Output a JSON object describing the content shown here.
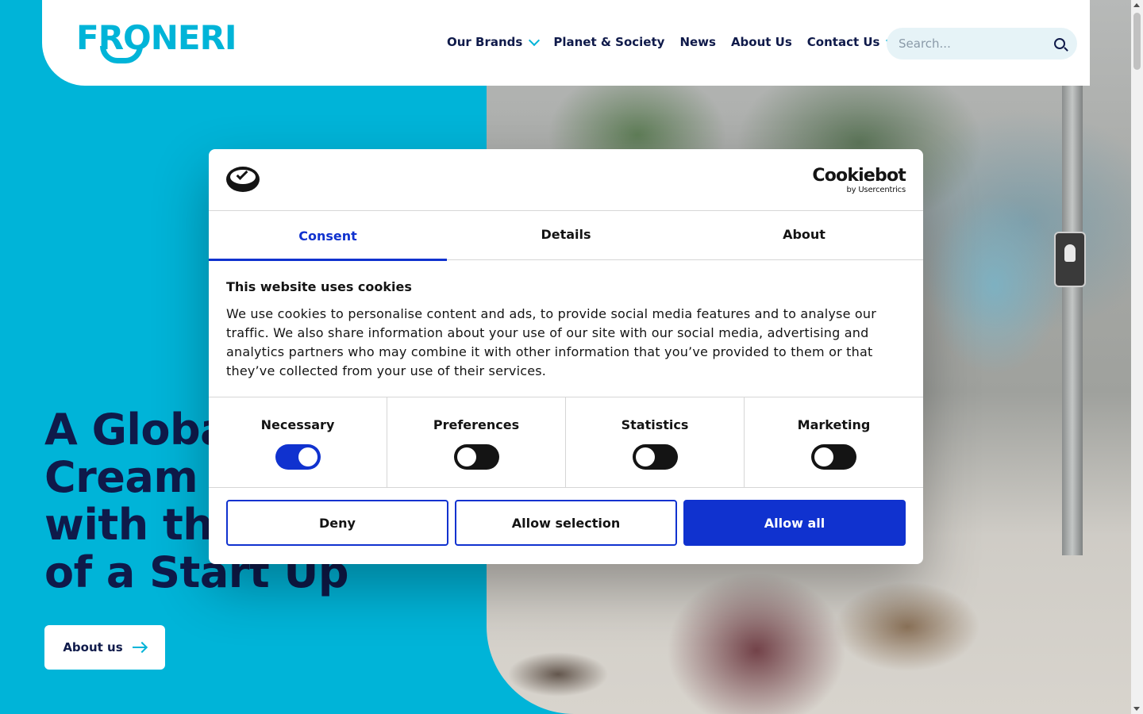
{
  "brand": {
    "logo_text": "FRONERI"
  },
  "nav": {
    "items": [
      {
        "label": "Our Brands",
        "has_dropdown": true
      },
      {
        "label": "Planet & Society",
        "has_dropdown": false
      },
      {
        "label": "News",
        "has_dropdown": false
      },
      {
        "label": "About Us",
        "has_dropdown": false
      },
      {
        "label": "Contact Us",
        "has_dropdown": true
      }
    ],
    "search_placeholder": "Search..."
  },
  "hero": {
    "heading_lines": [
      "A Global Ice",
      "Cream Business",
      "with the Energy",
      "of a Start Up"
    ],
    "cta_label": "About us"
  },
  "cookie_dialog": {
    "provider_name": "Cookiebot",
    "provider_sub": "by Usercentrics",
    "tabs": [
      "Consent",
      "Details",
      "About"
    ],
    "active_tab": "Consent",
    "title": "This website uses cookies",
    "body": "We use cookies to personalise content and ads, to provide social media features and to analyse our traffic. We also share information about your use of our site with our social media, advertising and analytics partners who may combine it with other information that you’ve provided to them or that they’ve collected from your use of their services.",
    "categories": [
      {
        "label": "Necessary",
        "enabled": true
      },
      {
        "label": "Preferences",
        "enabled": false
      },
      {
        "label": "Statistics",
        "enabled": false
      },
      {
        "label": "Marketing",
        "enabled": false
      }
    ],
    "buttons": {
      "deny": "Deny",
      "allow_selection": "Allow selection",
      "allow_all": "Allow all"
    }
  },
  "colors": {
    "brand_cyan": "#00b4d8",
    "navy": "#0f1a4a",
    "cookiebot_blue": "#1032cf"
  }
}
